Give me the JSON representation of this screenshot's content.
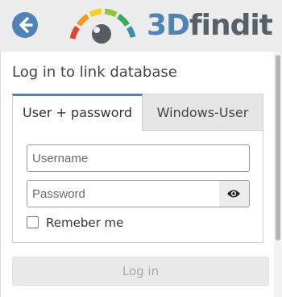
{
  "header": {
    "back_icon": "arrow-left-icon",
    "logo": {
      "part1": "3D",
      "part2": "findit"
    },
    "colors": {
      "brand_blue": "#4f82b6",
      "brand_gray": "#566068"
    }
  },
  "panel": {
    "title": "Log in to link database",
    "tabs": [
      {
        "label": "User + password",
        "active": true
      },
      {
        "label": "Windows-User",
        "active": false
      }
    ],
    "username": {
      "placeholder": "Username",
      "value": ""
    },
    "password": {
      "placeholder": "Password",
      "value": "",
      "toggle_icon": "eye-icon"
    },
    "remember": {
      "label": "Remeber me",
      "checked": false
    },
    "login_label": "Log in"
  }
}
